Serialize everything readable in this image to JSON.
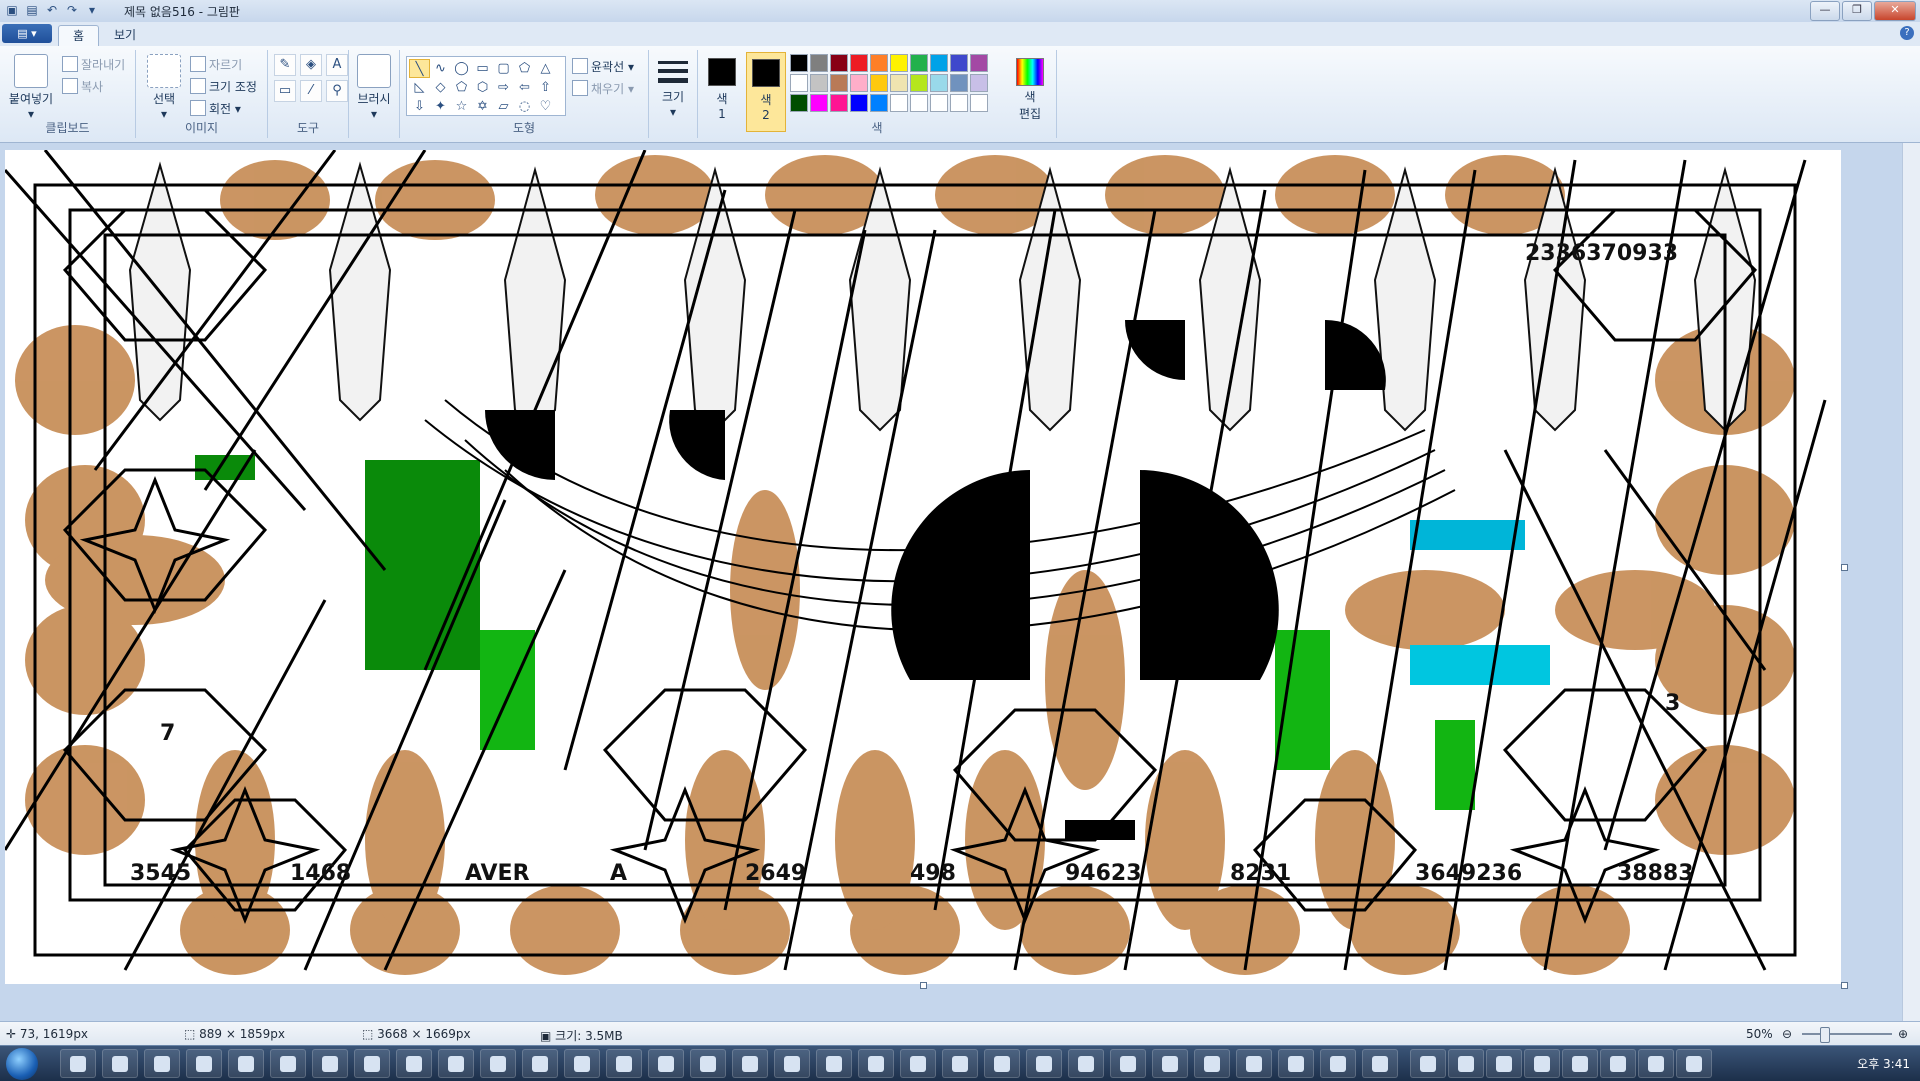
{
  "window": {
    "title": "제목 없음516 - 그림판"
  },
  "tabs": [
    "홈",
    "보기"
  ],
  "clipboard": {
    "paste": "붙여넣기",
    "cut": "잘라내기",
    "copy": "복사",
    "group": "클립보드"
  },
  "image": {
    "select": "선택",
    "crop": "자르기",
    "resize": "크기 조정",
    "rotate": "회전",
    "group": "이미지"
  },
  "tools": {
    "group": "도구",
    "brush": "브러시"
  },
  "shapes": {
    "outline": "윤곽선",
    "fill": "채우기",
    "group": "도형"
  },
  "size": {
    "label": "크기"
  },
  "colors": {
    "color1": "색\n1",
    "color2": "색\n2",
    "edit": "색\n편집",
    "group": "색",
    "color1_value": "#000000",
    "color2_value": "#000000",
    "palette": [
      "#000000",
      "#7f7f7f",
      "#880015",
      "#ed1c24",
      "#ff7f27",
      "#fff200",
      "#22b14c",
      "#00a2e8",
      "#3f48cc",
      "#a349a4",
      "#ffffff",
      "#c3c3c3",
      "#b97a57",
      "#ffaec9",
      "#ffc90e",
      "#efe4b0",
      "#b5e61d",
      "#99d9ea",
      "#7092be",
      "#c8bfe7",
      "#004d00",
      "#ff00ff",
      "#ff1493",
      "#0000ff",
      "#0080ff",
      "#ffffff",
      "#ffffff",
      "#ffffff",
      "#ffffff",
      "#ffffff"
    ]
  },
  "canvas": {
    "labels": [
      "3545",
      "1468",
      "AVER",
      "A",
      "2649",
      "498",
      "94623",
      "8231",
      "3649236",
      "38883",
      "2336370933",
      "7",
      "3"
    ]
  },
  "status": {
    "cursor": "73, 1619px",
    "selection": "889 × 1859px",
    "image_size": "3668 × 1669px",
    "file_size": "크기: 3.5MB",
    "zoom": "50%"
  },
  "clock": "오후 3:41"
}
